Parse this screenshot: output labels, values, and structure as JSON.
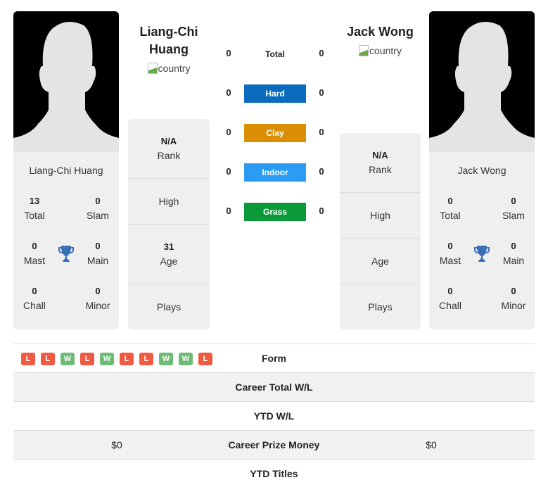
{
  "player_left": {
    "name": "Liang-Chi Huang",
    "header_name": "Liang-Chi Huang",
    "flag_alt": "country",
    "titles": {
      "total": {
        "value": "13",
        "label": "Total"
      },
      "slam": {
        "value": "0",
        "label": "Slam"
      },
      "mast": {
        "value": "0",
        "label": "Mast"
      },
      "main": {
        "value": "0",
        "label": "Main"
      },
      "chall": {
        "value": "0",
        "label": "Chall"
      },
      "minor": {
        "value": "0",
        "label": "Minor"
      }
    },
    "info": {
      "rank": {
        "value": "N/A",
        "label": "Rank"
      },
      "high": {
        "value": "",
        "label": "High"
      },
      "age": {
        "value": "31",
        "label": "Age"
      },
      "plays": {
        "value": "",
        "label": "Plays"
      }
    },
    "form": [
      "L",
      "L",
      "W",
      "L",
      "W",
      "L",
      "L",
      "W",
      "W",
      "L"
    ],
    "career_total_wl": "",
    "ytd_wl": "",
    "career_prize_money": "$0",
    "ytd_titles": ""
  },
  "player_right": {
    "name": "Jack Wong",
    "header_name": "Jack Wong",
    "flag_alt": "country",
    "titles": {
      "total": {
        "value": "0",
        "label": "Total"
      },
      "slam": {
        "value": "0",
        "label": "Slam"
      },
      "mast": {
        "value": "0",
        "label": "Mast"
      },
      "main": {
        "value": "0",
        "label": "Main"
      },
      "chall": {
        "value": "0",
        "label": "Chall"
      },
      "minor": {
        "value": "0",
        "label": "Minor"
      }
    },
    "info": {
      "rank": {
        "value": "N/A",
        "label": "Rank"
      },
      "high": {
        "value": "",
        "label": "High"
      },
      "age": {
        "value": "",
        "label": "Age"
      },
      "plays": {
        "value": "",
        "label": "Plays"
      }
    },
    "career_total_wl": "",
    "ytd_wl": "",
    "career_prize_money": "$0",
    "ytd_titles": ""
  },
  "h2h": [
    {
      "label": "Total",
      "left": "0",
      "right": "0",
      "color": ""
    },
    {
      "label": "Hard",
      "left": "0",
      "right": "0",
      "color": "#0a6bbf"
    },
    {
      "label": "Clay",
      "left": "0",
      "right": "0",
      "color": "#d98e04"
    },
    {
      "label": "Indoor",
      "left": "0",
      "right": "0",
      "color": "#2b9bf4"
    },
    {
      "label": "Grass",
      "left": "0",
      "right": "0",
      "color": "#0a9a3a"
    }
  ],
  "rows": {
    "form": "Form",
    "career_total_wl": "Career Total W/L",
    "ytd_wl": "YTD W/L",
    "career_prize_money": "Career Prize Money",
    "ytd_titles": "YTD Titles"
  },
  "colors": {
    "win": "#6dbb76",
    "loss": "#ee5b42",
    "trophy": "#3a70b8"
  }
}
